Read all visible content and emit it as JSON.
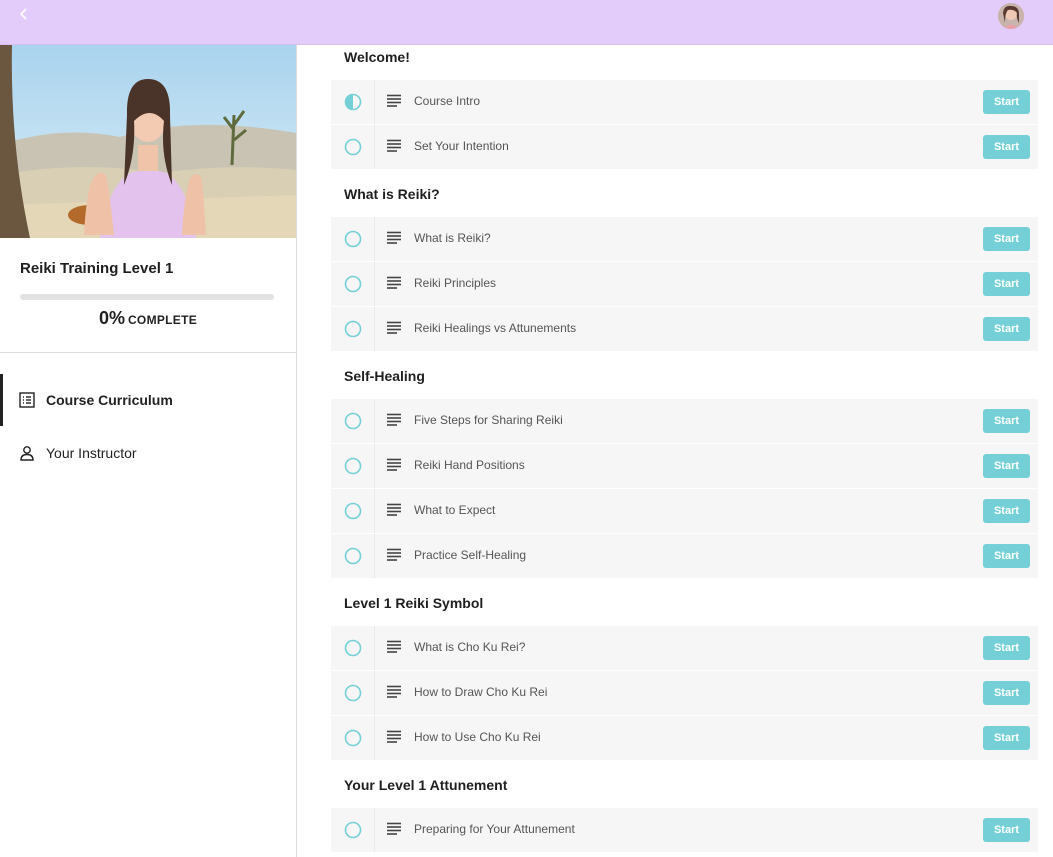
{
  "colors": {
    "topbar": "#e4ccfa",
    "accent": "#74d0d6",
    "row_background": "#f6f6f6"
  },
  "topbar": {
    "back_icon": "chevron-left-icon",
    "avatar_icon": "user-avatar"
  },
  "course": {
    "title": "Reiki Training Level 1",
    "progress_percent": 0,
    "progress_value": "0%",
    "progress_label": "COMPLETE"
  },
  "nav": [
    {
      "label": "Course Curriculum",
      "icon": "list-icon",
      "active": true
    },
    {
      "label": "Your Instructor",
      "icon": "person-icon",
      "active": false
    }
  ],
  "sections": [
    {
      "title": "Welcome!",
      "lectures": [
        {
          "title": "Course Intro",
          "status": "in-progress",
          "button": "Start"
        },
        {
          "title": "Set Your Intention",
          "status": "not-started",
          "button": "Start"
        }
      ]
    },
    {
      "title": "What is Reiki?",
      "lectures": [
        {
          "title": "What is Reiki?",
          "status": "not-started",
          "button": "Start"
        },
        {
          "title": "Reiki Principles",
          "status": "not-started",
          "button": "Start"
        },
        {
          "title": "Reiki Healings vs Attunements",
          "status": "not-started",
          "button": "Start"
        }
      ]
    },
    {
      "title": "Self-Healing",
      "lectures": [
        {
          "title": "Five Steps for Sharing Reiki",
          "status": "not-started",
          "button": "Start"
        },
        {
          "title": "Reiki Hand Positions",
          "status": "not-started",
          "button": "Start"
        },
        {
          "title": "What to Expect",
          "status": "not-started",
          "button": "Start"
        },
        {
          "title": "Practice Self-Healing",
          "status": "not-started",
          "button": "Start"
        }
      ]
    },
    {
      "title": "Level 1 Reiki Symbol",
      "lectures": [
        {
          "title": "What is Cho Ku Rei?",
          "status": "not-started",
          "button": "Start"
        },
        {
          "title": "How to Draw Cho Ku Rei",
          "status": "not-started",
          "button": "Start"
        },
        {
          "title": "How to Use Cho Ku Rei",
          "status": "not-started",
          "button": "Start"
        }
      ]
    },
    {
      "title": "Your Level 1 Attunement",
      "lectures": [
        {
          "title": "Preparing for Your Attunement",
          "status": "not-started",
          "button": "Start"
        }
      ]
    }
  ]
}
